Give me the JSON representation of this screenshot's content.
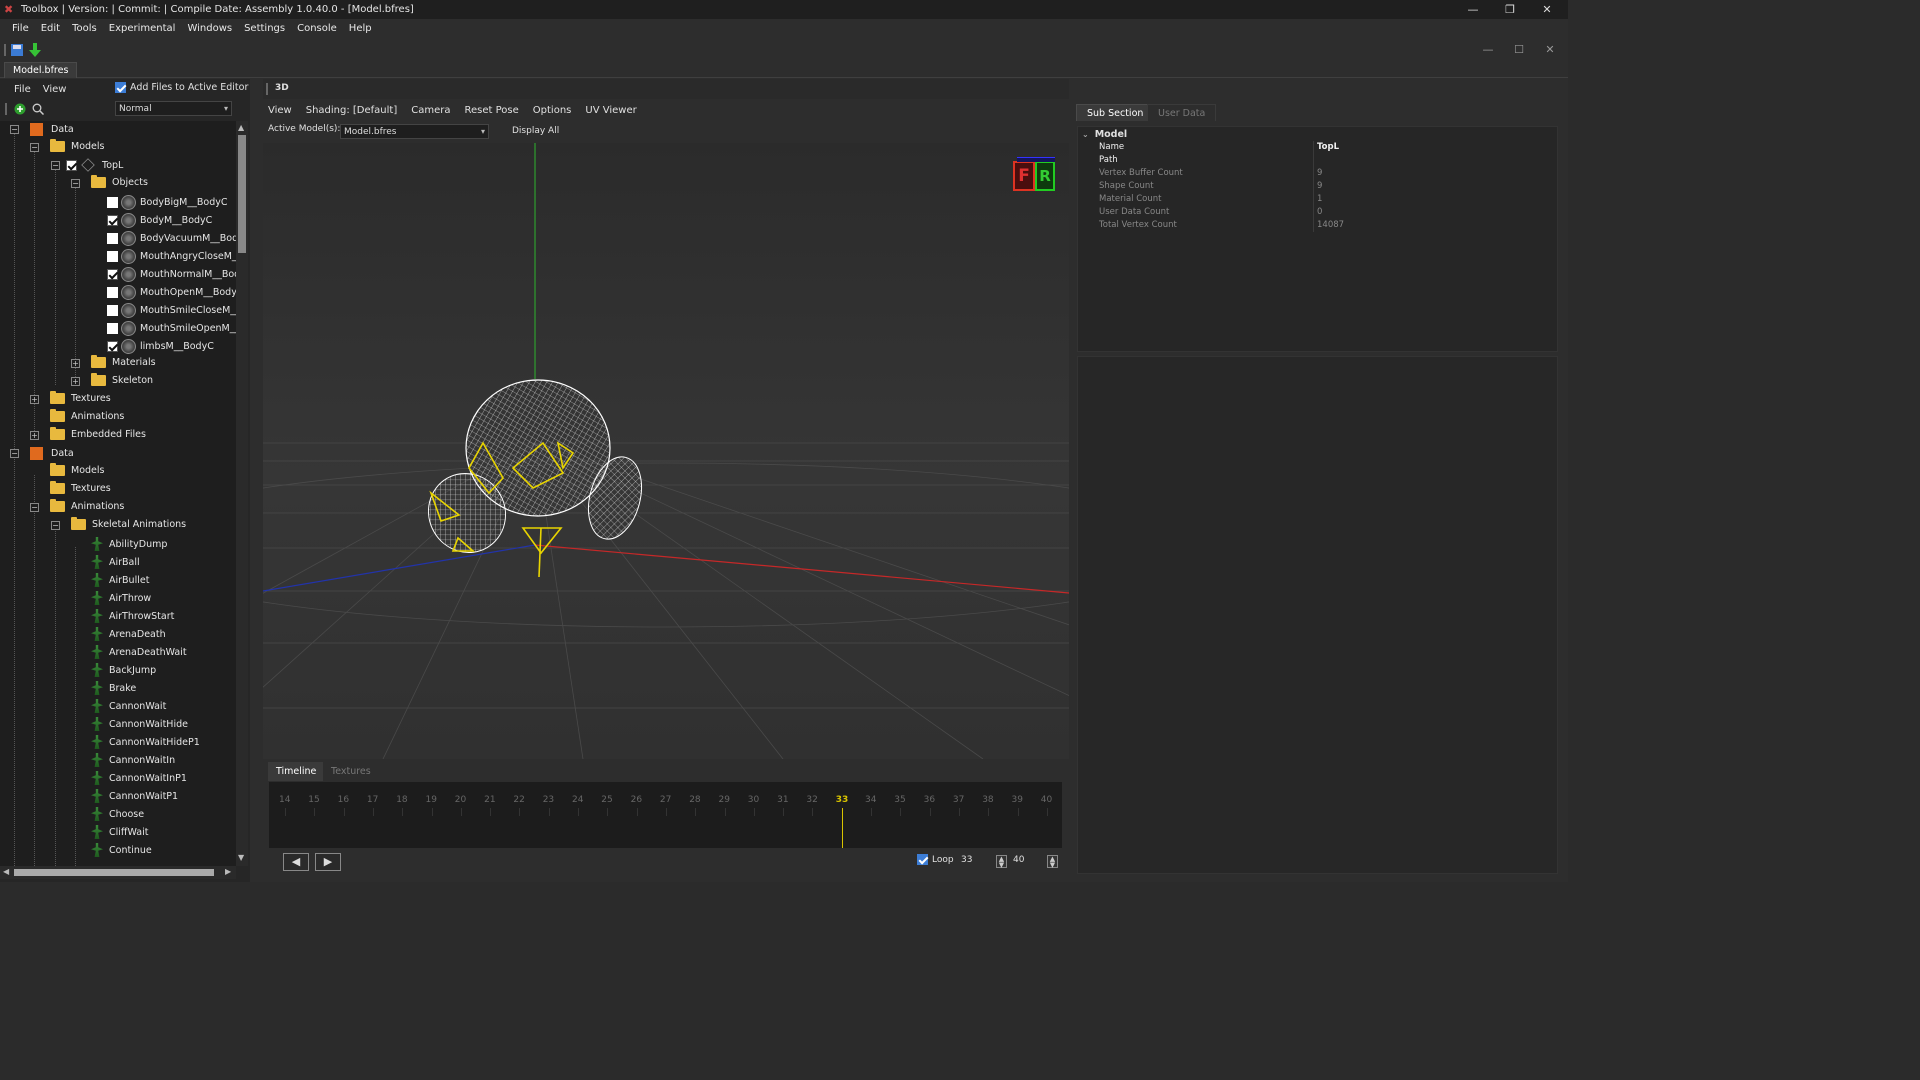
{
  "titlebar": {
    "text": "Toolbox | Version:  | Commit:  | Compile Date:  Assembly 1.0.40.0 - [Model.bfres]"
  },
  "menu": [
    "File",
    "Edit",
    "Tools",
    "Experimental",
    "Windows",
    "Settings",
    "Console",
    "Help"
  ],
  "doc_tab": "Model.bfres",
  "left_panel": {
    "menu": [
      "File",
      "View"
    ],
    "add_files_label": "Add Files to Active Editor",
    "add_files_checked": true,
    "mode_select": "Normal"
  },
  "tree": [
    {
      "label": "Data",
      "type": "bfres",
      "level": 0,
      "expander": "−"
    },
    {
      "label": "Models",
      "type": "folder",
      "level": 1,
      "expander": "−"
    },
    {
      "label": "TopL",
      "type": "model",
      "level": 2,
      "expander": "−",
      "checked": true
    },
    {
      "label": "Objects",
      "type": "folder",
      "level": 3,
      "expander": "−"
    },
    {
      "label": "BodyBigM__BodyC",
      "type": "mesh",
      "level": 4,
      "checked": false
    },
    {
      "label": "BodyM__BodyC",
      "type": "mesh",
      "level": 4,
      "checked": true
    },
    {
      "label": "BodyVacuumM__BodyC",
      "type": "mesh",
      "level": 4,
      "checked": false
    },
    {
      "label": "MouthAngryCloseM__Bo",
      "type": "mesh",
      "level": 4,
      "checked": false
    },
    {
      "label": "MouthNormalM__BodyC",
      "type": "mesh",
      "level": 4,
      "checked": true
    },
    {
      "label": "MouthOpenM__BodyC",
      "type": "mesh",
      "level": 4,
      "checked": false
    },
    {
      "label": "MouthSmileCloseM__Boc",
      "type": "mesh",
      "level": 4,
      "checked": false
    },
    {
      "label": "MouthSmileOpenM__Boc",
      "type": "mesh",
      "level": 4,
      "checked": false
    },
    {
      "label": "limbsM__BodyC",
      "type": "mesh",
      "level": 4,
      "checked": true
    },
    {
      "label": "Materials",
      "type": "folder",
      "level": 3,
      "expander": "+"
    },
    {
      "label": "Skeleton",
      "type": "folder",
      "level": 3,
      "expander": "+"
    },
    {
      "label": "Textures",
      "type": "folder",
      "level": 1,
      "expander": "+"
    },
    {
      "label": "Animations",
      "type": "folder",
      "level": 1
    },
    {
      "label": "Embedded Files",
      "type": "folder",
      "level": 1,
      "expander": "+"
    },
    {
      "label": "Data",
      "type": "bfres",
      "level": 0,
      "expander": "−"
    },
    {
      "label": "Models",
      "type": "folder",
      "level": 1
    },
    {
      "label": "Textures",
      "type": "folder",
      "level": 1
    },
    {
      "label": "Animations",
      "type": "folder",
      "level": 1,
      "expander": "−"
    },
    {
      "label": "Skeletal Animations",
      "type": "folder",
      "level": 2,
      "expander": "−"
    },
    {
      "label": "AbilityDump",
      "type": "anim",
      "level": 3
    },
    {
      "label": "AirBall",
      "type": "anim",
      "level": 3
    },
    {
      "label": "AirBullet",
      "type": "anim",
      "level": 3
    },
    {
      "label": "AirThrow",
      "type": "anim",
      "level": 3
    },
    {
      "label": "AirThrowStart",
      "type": "anim",
      "level": 3
    },
    {
      "label": "ArenaDeath",
      "type": "anim",
      "level": 3
    },
    {
      "label": "ArenaDeathWait",
      "type": "anim",
      "level": 3
    },
    {
      "label": "BackJump",
      "type": "anim",
      "level": 3
    },
    {
      "label": "Brake",
      "type": "anim",
      "level": 3
    },
    {
      "label": "CannonWait",
      "type": "anim",
      "level": 3
    },
    {
      "label": "CannonWaitHide",
      "type": "anim",
      "level": 3
    },
    {
      "label": "CannonWaitHideP1",
      "type": "anim",
      "level": 3
    },
    {
      "label": "CannonWaitIn",
      "type": "anim",
      "level": 3
    },
    {
      "label": "CannonWaitInP1",
      "type": "anim",
      "level": 3
    },
    {
      "label": "CannonWaitP1",
      "type": "anim",
      "level": 3
    },
    {
      "label": "Choose",
      "type": "anim",
      "level": 3
    },
    {
      "label": "CliffWait",
      "type": "anim",
      "level": 3
    },
    {
      "label": "Continue",
      "type": "anim",
      "level": 3
    }
  ],
  "viewport": {
    "header": "3D",
    "menu": [
      "View",
      "Shading: [Default]",
      "Camera",
      "Reset Pose",
      "Options",
      "UV Viewer"
    ],
    "active_models_label": "Active Model(s):",
    "active_models_value": "Model.bfres",
    "display_all_label": "Display All",
    "display_all_checked": false,
    "gizmo": {
      "f": "F",
      "r": "R"
    }
  },
  "properties": {
    "tabs": [
      "Sub Section",
      "User Data"
    ],
    "active_tab": "Sub Section",
    "section": "Model",
    "rows": [
      {
        "key": "Name",
        "value": "TopL",
        "enabled": true
      },
      {
        "key": "Path",
        "value": "",
        "enabled": true
      },
      {
        "key": "Vertex Buffer Count",
        "value": "9",
        "enabled": false
      },
      {
        "key": "Shape Count",
        "value": "9",
        "enabled": false
      },
      {
        "key": "Material Count",
        "value": "1",
        "enabled": false
      },
      {
        "key": "User Data Count",
        "value": "0",
        "enabled": false
      },
      {
        "key": "Total Vertex Count",
        "value": "14087",
        "enabled": false
      }
    ]
  },
  "timeline": {
    "tabs": [
      "Timeline",
      "Textures"
    ],
    "active_tab": "Timeline",
    "ruler": [
      "14",
      "15",
      "16",
      "17",
      "18",
      "19",
      "20",
      "21",
      "22",
      "23",
      "24",
      "25",
      "26",
      "27",
      "28",
      "29",
      "30",
      "31",
      "32",
      "33",
      "34",
      "35",
      "36",
      "37",
      "38",
      "39",
      "40"
    ],
    "current_frame": "33",
    "loop_label": "Loop",
    "loop_checked": true,
    "frame_value": "33",
    "end_value": "40",
    "prev_label": "◀",
    "next_label": "▶"
  },
  "colors": {
    "accent": "#3c7dd6",
    "frame_highlight": "#d9c400",
    "axis_x": "#c62828",
    "axis_y": "#2e9e2e",
    "axis_z": "#2233aa",
    "wire_body": "#ffffff",
    "wire_bones": "#e8d400"
  }
}
